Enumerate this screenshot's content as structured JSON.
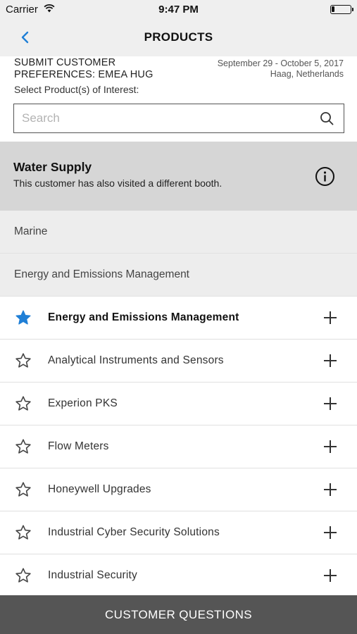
{
  "status_bar": {
    "carrier": "Carrier",
    "time": "9:47 PM",
    "battery_icon": "battery-low-icon",
    "wifi_icon": "wifi-icon"
  },
  "nav": {
    "title": "PRODUCTS",
    "back_icon": "chevron-left-icon",
    "accent_color": "#1f7fd6"
  },
  "event": {
    "title_line1": "SUBMIT CUSTOMER",
    "title_line2": "PREFERENCES: EMEA HUG",
    "dates": "September 29 - October 5, 2017",
    "location": "Haag, Netherlands"
  },
  "select_label": "Select Product(s) of Interest:",
  "search": {
    "placeholder": "Search",
    "value": ""
  },
  "section": {
    "title": "Water Supply",
    "subtitle": "This customer has also visited a different booth.",
    "icon": "info-icon"
  },
  "categories": [
    {
      "label": "Marine"
    },
    {
      "label": "Energy and Emissions Management"
    }
  ],
  "products": [
    {
      "label": "Energy and Emissions Management",
      "starred": true
    },
    {
      "label": "Analytical Instruments and Sensors",
      "starred": false
    },
    {
      "label": "Experion PKS",
      "starred": false
    },
    {
      "label": "Flow Meters",
      "starred": false
    },
    {
      "label": "Honeywell Upgrades",
      "starred": false
    },
    {
      "label": "Industrial Cyber Security Solutions",
      "starred": false
    },
    {
      "label": "Industrial Security",
      "starred": false
    }
  ],
  "footer": {
    "label": "CUSTOMER QUESTIONS"
  }
}
